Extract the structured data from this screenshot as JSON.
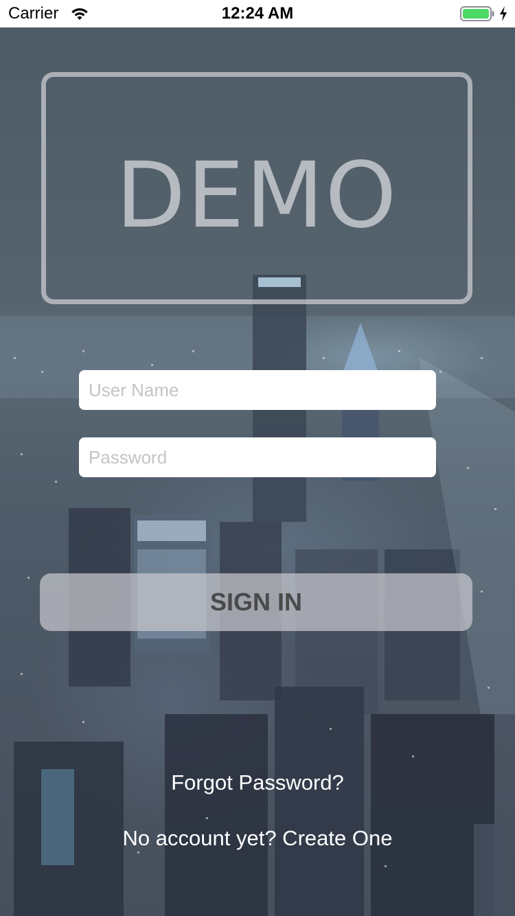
{
  "status_bar": {
    "carrier": "Carrier",
    "time": "12:24 AM",
    "battery_color": "#4cd964"
  },
  "logo": {
    "text": "DEMO"
  },
  "form": {
    "username_placeholder": "User Name",
    "password_placeholder": "Password",
    "signin_label": "SIGN IN"
  },
  "links": {
    "forgot_password": "Forgot Password?",
    "create_account": "No account yet? Create One"
  },
  "colors": {
    "link_text": "#ffffff",
    "button_text": "#4a4a4c"
  }
}
